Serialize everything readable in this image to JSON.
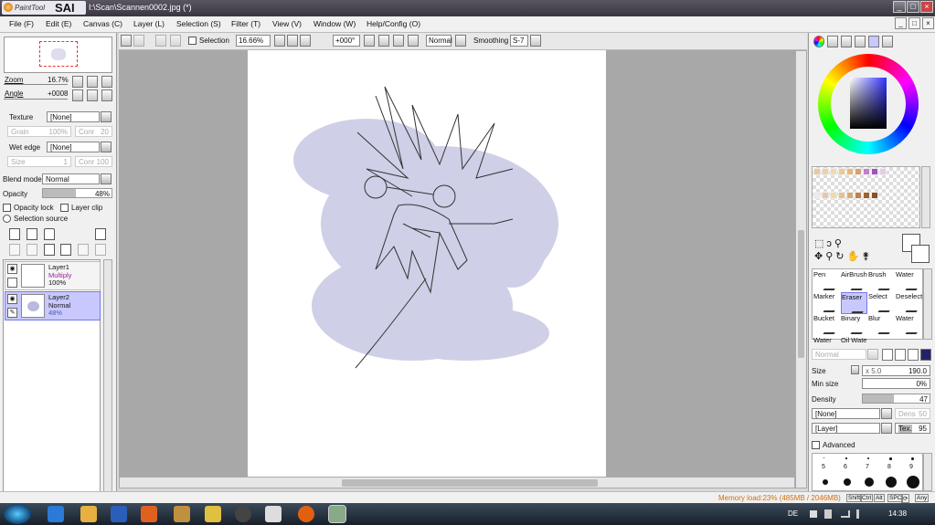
{
  "app": {
    "logo_small": "PaintTool",
    "logo_big": "SAI",
    "title": "I:\\Scan\\Scannen0002.jpg (*)",
    "win_buttons": [
      "_",
      "□",
      "×"
    ],
    "menu_buttons": [
      "_",
      "□",
      "×"
    ]
  },
  "menu": [
    "File (F)",
    "Edit (E)",
    "Canvas (C)",
    "Layer (L)",
    "Selection (S)",
    "Filter (T)",
    "View (V)",
    "Window (W)",
    "Help/Config (O)"
  ],
  "toolbar": {
    "selection_label": "Selection",
    "zoom": "16.66%",
    "rotation": "+000°",
    "blend": "Normal",
    "smoothing_label": "Smoothing",
    "smoothing": "S-7"
  },
  "navigator": {
    "zoom_label": "Zoom",
    "zoom_value": "16.7%",
    "angle_label": "Angle",
    "angle_value": "+0008"
  },
  "layer_settings": {
    "texture_label": "Texture",
    "texture_value": "[None]",
    "grain_label": "Grain",
    "grain_value": "100%",
    "conr_label": "Conr",
    "conr_value": "20",
    "wet_edge_label": "Wet edge",
    "wet_edge_value": "[None]",
    "size_label": "Size",
    "size_value": "1",
    "conr2_label": "Conr",
    "conr2_value": "100",
    "blend_mode_label": "Blend mode",
    "blend_mode_value": "Normal",
    "opacity_label": "Opacity",
    "opacity_value": "48%",
    "opacity_fraction": 0.48,
    "opacity_lock": "Opacity lock",
    "layer_clip": "Layer clip",
    "selection_source": "Selection source"
  },
  "layers": [
    {
      "name": "Layer1",
      "mode": "Multiply",
      "opacity": "100%",
      "selected": false
    },
    {
      "name": "Layer2",
      "mode": "Normal",
      "opacity": "48%",
      "selected": true
    }
  ],
  "brush": {
    "tools": [
      "Pen",
      "AirBrush",
      "Brush",
      "Water",
      "Marker",
      "Eraser",
      "Select",
      "Deselect",
      "Bucket",
      "Binary",
      "Blur",
      "Water",
      "Water",
      "Oil Wate"
    ],
    "mode_value": "Normal",
    "size_label": "Size",
    "size_mult": "x 5.0",
    "size_value": "190.0",
    "min_size_label": "Min size",
    "min_size_value": "0%",
    "density_label": "Density",
    "density_value": "47",
    "density_fraction": 0.47,
    "shape_value": "[None]",
    "dens_label": "Dens",
    "dens_value": "50",
    "texture_value": "[Layer]",
    "tex_label": "Tex.",
    "tex_value": "95",
    "advanced_label": "Advanced",
    "preset_sizes": [
      "5",
      "6",
      "7",
      "8",
      "9"
    ]
  },
  "colors": {
    "accent": "#c8c8ff",
    "swatches": [
      "#e8c8a0",
      "#f0d0a8",
      "#f4d8b0",
      "#f0c890",
      "#e8b878",
      "#d8a070",
      "#c080d0",
      "#a050c0",
      "#e0d0e0",
      "#f0e8f0",
      "#e8c8a0",
      "#f0d8a8",
      "#e8c090",
      "#d8a878",
      "#c08050",
      "#a06030",
      "#8a5028"
    ]
  },
  "status": {
    "memory": "Memory load:23% (485MB / 2046MB)",
    "keys": [
      "Shift",
      "Ctrl",
      "Alt",
      "SPC",
      "⟳",
      "Any"
    ]
  },
  "taskbar": {
    "lang": "DE",
    "clock": "14:38"
  }
}
